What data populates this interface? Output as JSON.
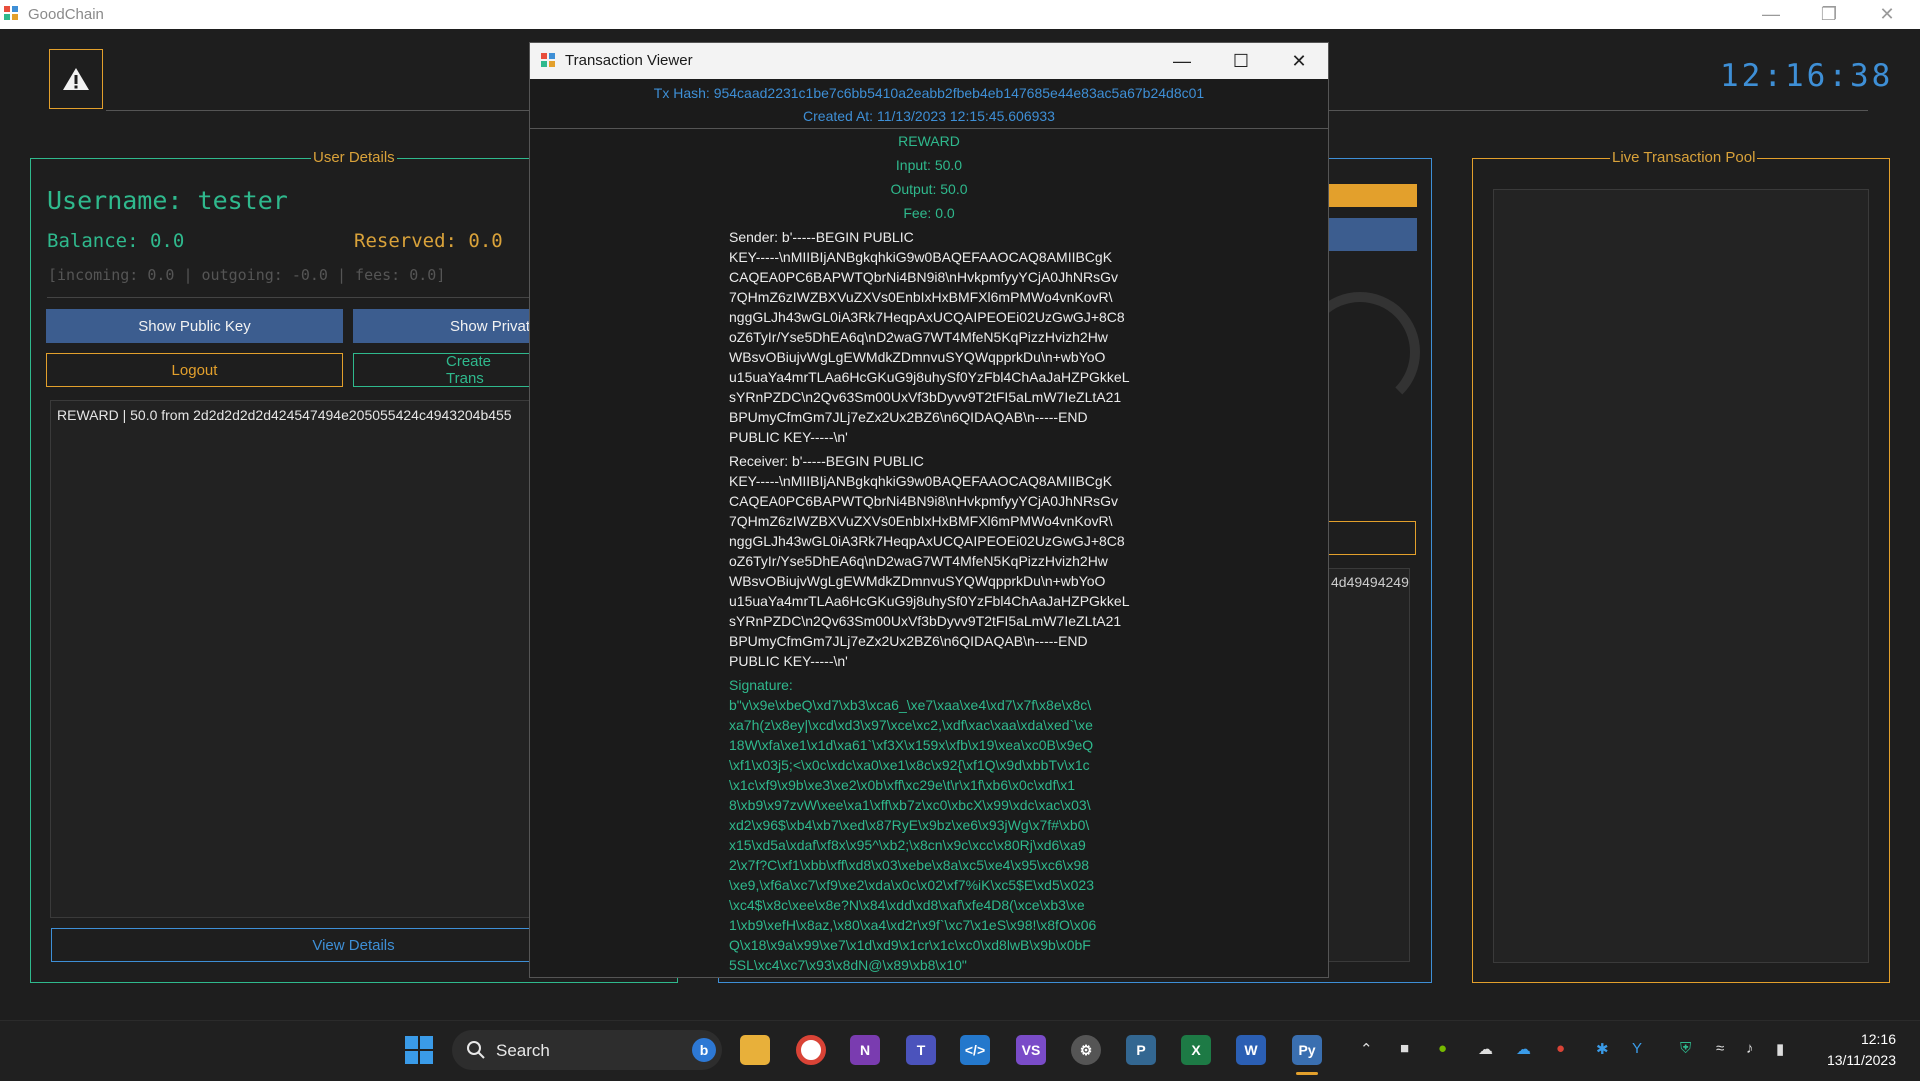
{
  "main_window": {
    "title": "GoodChain"
  },
  "header": {
    "clock": "12:16:38"
  },
  "user_details": {
    "group_title": "User Details",
    "username": "Username: tester",
    "balance": "Balance: 0.0",
    "reserved": "Reserved: 0.0",
    "flows": "[incoming: 0.0 | outgoing: -0.0 | fees: 0.0]",
    "buttons": {
      "show_public_key": "Show Public Key",
      "show_private_key": "Show Privat",
      "logout": "Logout",
      "create_transaction": "Create Trans",
      "view_details": "View Details"
    },
    "transactions": [
      "REWARD | 50.0 from 2d2d2d2d2d424547494e205055424c4943204b455"
    ]
  },
  "middle_panel": {
    "list_items": [
      "4d49494249"
    ]
  },
  "pool": {
    "group_title": "Live Transaction Pool"
  },
  "dialog": {
    "title": "Transaction Viewer",
    "tx_hash": "Tx Hash: 954caad2231c1be7c6bb5410a2eabb2fbeb4eb147685e44e83ac5a67b24d8c01",
    "created_at": "Created At: 11/13/2023 12:15:45.606933",
    "type": "REWARD",
    "input": "Input: 50.0",
    "output": "Output: 50.0",
    "fee": "Fee: 0.0",
    "sender": "Sender: b'-----BEGIN PUBLIC\nKEY-----\\nMIIBIjANBgkqhkiG9w0BAQEFAAOCAQ8AMIIBCgK\nCAQEA0PC6BAPWTQbrNi4BN9i8\\nHvkpmfyyYCjA0JhNRsGv\n7QHmZ6zIWZBXVuZXVs0EnbIxHxBMFXl6mPMWo4vnKovR\\\nnggGLJh43wGL0iA3Rk7HeqpAxUCQAIPEOEi02UzGwGJ+8C8\noZ6TyIr/Yse5DhEA6q\\nD2waG7WT4MfeN5KqPizzHvizh2Hw\nWBsvOBiujvWgLgEWMdkZDmnvuSYQWqpprkDu\\n+wbYoO\nu15uaYa4mrTLAa6HcGKuG9j8uhySf0YzFbl4ChAaJaHZPGkkeL\nsYRnPZDC\\n2Qv63Sm00UxVf3bDyvv9T2tFI5aLmW7IeZLtA21\nBPUmyCfmGm7JLj7eZx2Ux2BZ6\\n6QIDAQAB\\n-----END\nPUBLIC KEY-----\\n'",
    "receiver": "Receiver: b'-----BEGIN PUBLIC\nKEY-----\\nMIIBIjANBgkqhkiG9w0BAQEFAAOCAQ8AMIIBCgK\nCAQEA0PC6BAPWTQbrNi4BN9i8\\nHvkpmfyyYCjA0JhNRsGv\n7QHmZ6zIWZBXVuZXVs0EnbIxHxBMFXl6mPMWo4vnKovR\\\nnggGLJh43wGL0iA3Rk7HeqpAxUCQAIPEOEi02UzGwGJ+8C8\noZ6TyIr/Yse5DhEA6q\\nD2waG7WT4MfeN5KqPizzHvizh2Hw\nWBsvOBiujvWgLgEWMdkZDmnvuSYQWqpprkDu\\n+wbYoO\nu15uaYa4mrTLAa6HcGKuG9j8uhySf0YzFbl4ChAaJaHZPGkkeL\nsYRnPZDC\\n2Qv63Sm00UxVf3bDyvv9T2tFI5aLmW7IeZLtA21\nBPUmyCfmGm7JLj7eZx2Ux2BZ6\\n6QIDAQAB\\n-----END\nPUBLIC KEY-----\\n'",
    "signature": "Signature:\nb\"v\\x9e\\xbeQ\\xd7\\xb3\\xca6_\\xe7\\xaa\\xe4\\xd7\\x7f\\x8e\\x8c\\\nxa7h(z\\x8ey|\\xcd\\xd3\\x97\\xce\\xc2,\\xdf\\xac\\xaa\\xda\\xed`\\xe\n18W\\xfa\\xe1\\x1d\\xa61`\\xf3X\\x159x\\xfb\\x19\\xea\\xc0B\\x9eQ\n\\xf1\\x03j5;<\\x0c\\xdc\\xa0\\xe1\\x8c\\x92{\\xf1Q\\x9d\\xbbTv\\x1c\n\\x1c\\xf9\\x9b\\xe3\\xe2\\x0b\\xff\\xc29e\\t\\r\\x1f\\xb6\\x0c\\xdf\\x1\n8\\xb9\\x97zvW\\xee\\xa1\\xff\\xb7z\\xc0\\xbcX\\x99\\xdc\\xac\\x03\\\nxd2\\x96$\\xb4\\xb7\\xed\\x87RyE\\x9bz\\xe6\\x93jWg\\x7f#\\xb0\\\nx15\\xd5a\\xdaf\\xf8x\\x95^\\xb2;\\x8cn\\x9c\\xcc\\x80Rj\\xd6\\xa9\n2\\x7f?C\\xf1\\xbb\\xff\\xd8\\x03\\xebe\\x8a\\xc5\\xe4\\x95\\xc6\\x98\n\\xe9,\\xf6a\\xc7\\xf9\\xe2\\xda\\x0c\\x02\\xf7%iK\\xc5$E\\xd5\\x023\n\\xc4$\\x8c\\xee\\x8e?N\\x84\\xdd\\xd8\\xaf\\xfe4D8(\\xce\\xb3\\xe\n1\\xb9\\xefH\\x8az,\\x80\\xa4\\xd2r\\x9f`\\xc7\\x1eS\\x98!\\x8fO\\x06\nQ\\x18\\x9a\\x99\\xe7\\x1d\\xd9\\x1cr\\x1c\\xc0\\xd8lwB\\x9b\\x0bF\n5SL\\xc4\\xc7\\x93\\x8dN@\\x89\\xb8\\x10\""
  },
  "taskbar": {
    "search_label": "Search",
    "time": "12:16",
    "date": "13/11/2023"
  },
  "colors": {
    "green": "#2fb98d",
    "orange": "#e3a02c",
    "blue": "#3e8fd6",
    "button_blue": "#3c5d8f"
  }
}
